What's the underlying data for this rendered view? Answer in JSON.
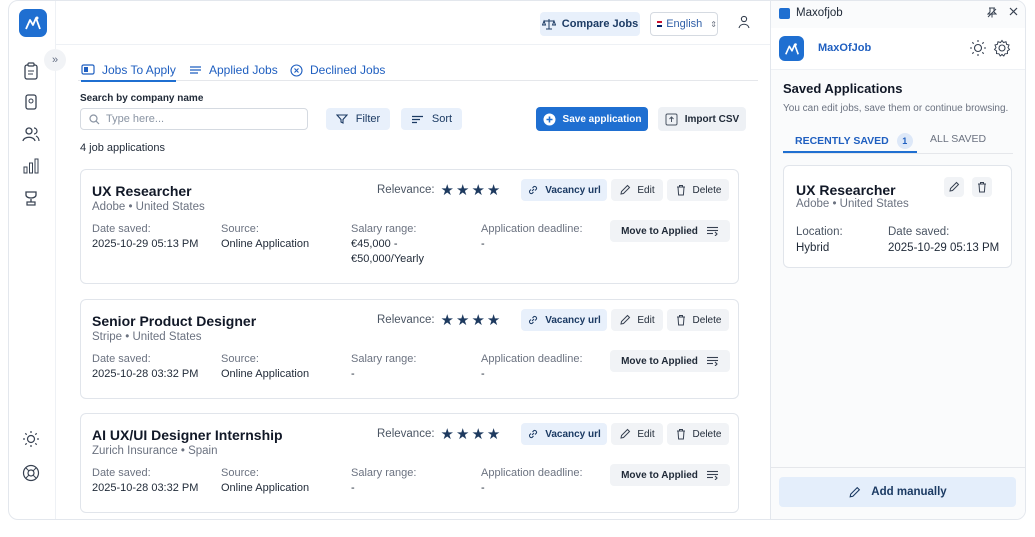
{
  "brand": {
    "accent": "#1f6fd1",
    "star_color": "#1e3a5f"
  },
  "topbar": {
    "compare_label": "Compare Jobs",
    "language": "English"
  },
  "tabs": [
    {
      "label": "Jobs To Apply",
      "icon": "inbox-icon",
      "active": true
    },
    {
      "label": "Applied Jobs",
      "icon": "list-icon",
      "active": false
    },
    {
      "label": "Declined Jobs",
      "icon": "x-circle-icon",
      "active": false
    }
  ],
  "search": {
    "label": "Search by company name",
    "placeholder": "Type here..."
  },
  "toolbar": {
    "filter_label": "Filter",
    "sort_label": "Sort",
    "save_label": "Save application",
    "import_label": "Import CSV"
  },
  "summary": {
    "count_text": "4 job applications"
  },
  "card_labels": {
    "relevance": "Relevance:",
    "vacancy": "Vacancy url",
    "edit": "Edit",
    "delete": "Delete",
    "date_saved": "Date saved:",
    "source": "Source:",
    "salary": "Salary range:",
    "deadline": "Application deadline:",
    "move": "Move to Applied"
  },
  "jobs": [
    {
      "title": "UX Researcher",
      "company": "Adobe • United States",
      "stars": 4,
      "date_saved": "2025-10-29 05:13 PM",
      "source": "Online Application",
      "salary_line1": "€45,000 -",
      "salary_line2": "€50,000/Yearly",
      "deadline": "-"
    },
    {
      "title": "Senior Product Designer",
      "company": "Stripe • United States",
      "stars": 4,
      "date_saved": "2025-10-28 03:32 PM",
      "source": "Online Application",
      "salary_line1": "-",
      "salary_line2": "",
      "deadline": "-"
    },
    {
      "title": "AI UX/UI Designer Internship",
      "company": "Zurich Insurance • Spain",
      "stars": 4,
      "date_saved": "2025-10-28 03:32 PM",
      "source": "Online Application",
      "salary_line1": "-",
      "salary_line2": "",
      "deadline": "-"
    }
  ],
  "panel": {
    "window_title": "Maxofjob",
    "brand_name": "MaxOfJob",
    "saved_title": "Saved Applications",
    "saved_sub": "You can edit jobs, save them or continue browsing.",
    "tab_recent": "RECENTLY SAVED",
    "recent_count": "1",
    "tab_all": "ALL SAVED",
    "card": {
      "title": "UX Researcher",
      "company": "Adobe • United States",
      "location_label": "Location:",
      "location": "Hybrid",
      "date_label": "Date saved:",
      "date": "2025-10-29 05:13 PM"
    },
    "add_label": "Add manually"
  }
}
